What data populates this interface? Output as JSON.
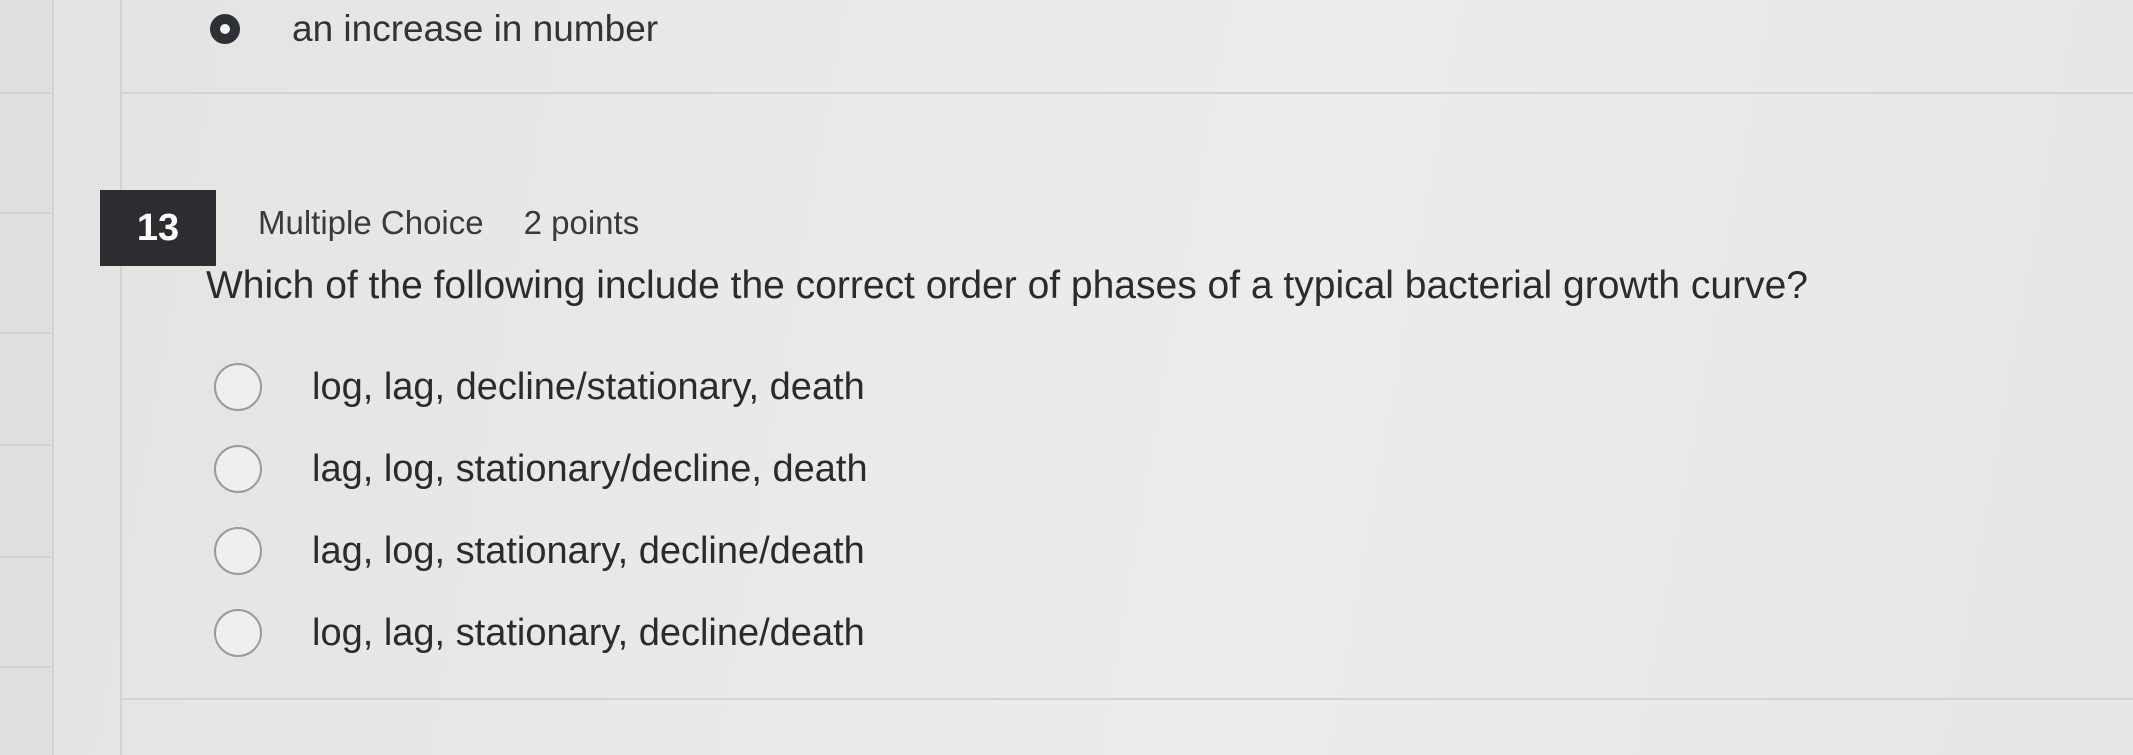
{
  "previous_question": {
    "selected_option_label": "an increase in number"
  },
  "question": {
    "number": "13",
    "type": "Multiple Choice",
    "points": "2 points",
    "prompt": "Which of the following include the correct order of phases of a typical bacterial growth curve?",
    "options": [
      {
        "label": "log, lag, decline/stationary, death"
      },
      {
        "label": "lag, log, stationary/decline, death"
      },
      {
        "label": "lag, log, stationary, decline/death"
      },
      {
        "label": "log, lag, stationary, decline/death"
      }
    ]
  }
}
